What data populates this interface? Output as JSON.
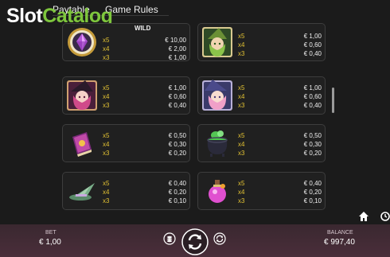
{
  "watermark": {
    "part1": "Slot",
    "part2": "Catalog"
  },
  "tabs": {
    "paytable": "Paytable",
    "rules": "Game Rules"
  },
  "cards": [
    {
      "symbol": "purple-gem-icon",
      "label": "WILD",
      "rows": [
        {
          "mult": "x5",
          "pay": "€ 10,00"
        },
        {
          "mult": "x4",
          "pay": "€ 2,00"
        },
        {
          "mult": "x3",
          "pay": "€ 1,00"
        }
      ]
    },
    {
      "symbol": "green-witch-icon",
      "rows": [
        {
          "mult": "x5",
          "pay": "€ 1,00"
        },
        {
          "mult": "x4",
          "pay": "€ 0,60"
        },
        {
          "mult": "x3",
          "pay": "€ 0,40"
        }
      ]
    },
    {
      "symbol": "pink-witch-icon",
      "rows": [
        {
          "mult": "x5",
          "pay": "€ 1,00"
        },
        {
          "mult": "x4",
          "pay": "€ 0,60"
        },
        {
          "mult": "x3",
          "pay": "€ 0,40"
        }
      ]
    },
    {
      "symbol": "blue-witch-icon",
      "rows": [
        {
          "mult": "x5",
          "pay": "€ 1,00"
        },
        {
          "mult": "x4",
          "pay": "€ 0,60"
        },
        {
          "mult": "x3",
          "pay": "€ 0,40"
        }
      ]
    },
    {
      "symbol": "spellbook-icon",
      "rows": [
        {
          "mult": "x5",
          "pay": "€ 0,50"
        },
        {
          "mult": "x4",
          "pay": "€ 0,30"
        },
        {
          "mult": "x3",
          "pay": "€ 0,20"
        }
      ]
    },
    {
      "symbol": "cauldron-icon",
      "rows": [
        {
          "mult": "x5",
          "pay": "€ 0,50"
        },
        {
          "mult": "x4",
          "pay": "€ 0,30"
        },
        {
          "mult": "x3",
          "pay": "€ 0,20"
        }
      ]
    },
    {
      "symbol": "witch-hat-icon",
      "rows": [
        {
          "mult": "x5",
          "pay": "€ 0,40"
        },
        {
          "mult": "x4",
          "pay": "€ 0,20"
        },
        {
          "mult": "x3",
          "pay": "€ 0,10"
        }
      ]
    },
    {
      "symbol": "potion-icon",
      "rows": [
        {
          "mult": "x5",
          "pay": "€ 0,40"
        },
        {
          "mult": "x4",
          "pay": "€ 0,20"
        },
        {
          "mult": "x3",
          "pay": "€ 0,10"
        }
      ]
    }
  ],
  "footer": {
    "bet_label": "BET",
    "bet_value": "€ 1,00",
    "balance_label": "BALANCE",
    "balance_value": "€ 997,40"
  },
  "colors": {
    "multiplier": "#e0c033",
    "background": "#1b1b1b",
    "bar": "#4a2e3a"
  }
}
